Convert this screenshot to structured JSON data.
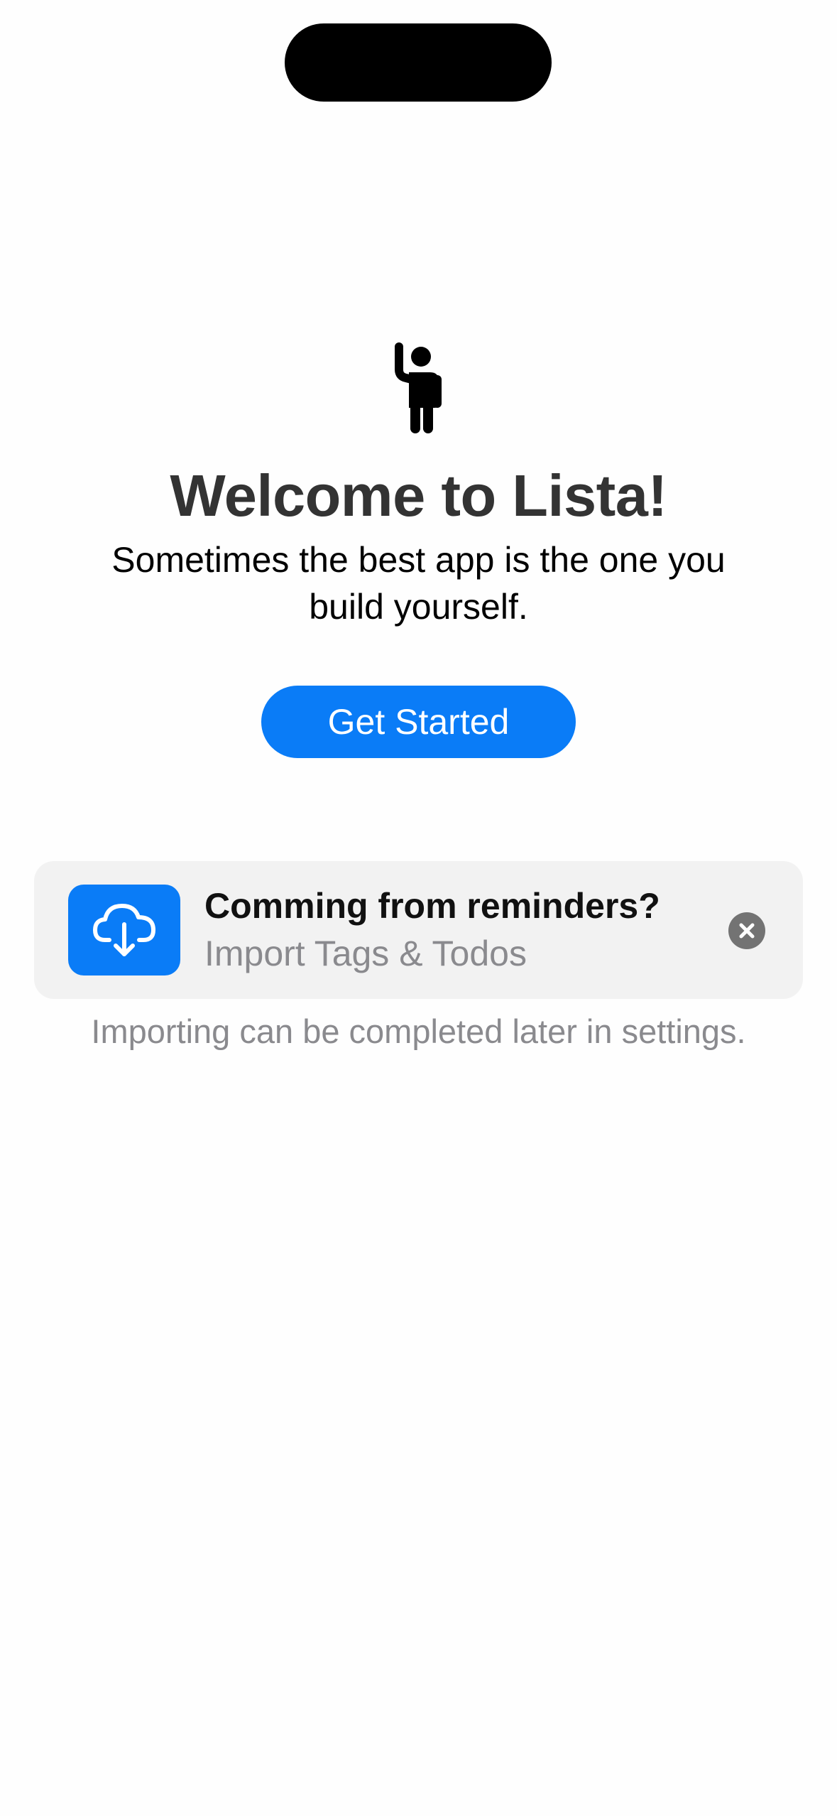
{
  "welcome": {
    "icon": "person-waving-icon",
    "title": "Welcome to Lista!",
    "subtitle": "Sometimes the best app is the one you build yourself.",
    "get_started_label": "Get Started"
  },
  "import_card": {
    "icon": "cloud-download-icon",
    "title": "Comming from reminders?",
    "subtitle": "Import Tags & Todos",
    "close_icon": "close-icon"
  },
  "import_note": "Importing can be completed later in settings.",
  "colors": {
    "accent": "#0a7cf7",
    "title_text": "#333333",
    "secondary_text": "#8a8a8e",
    "card_background": "#f2f2f2"
  }
}
